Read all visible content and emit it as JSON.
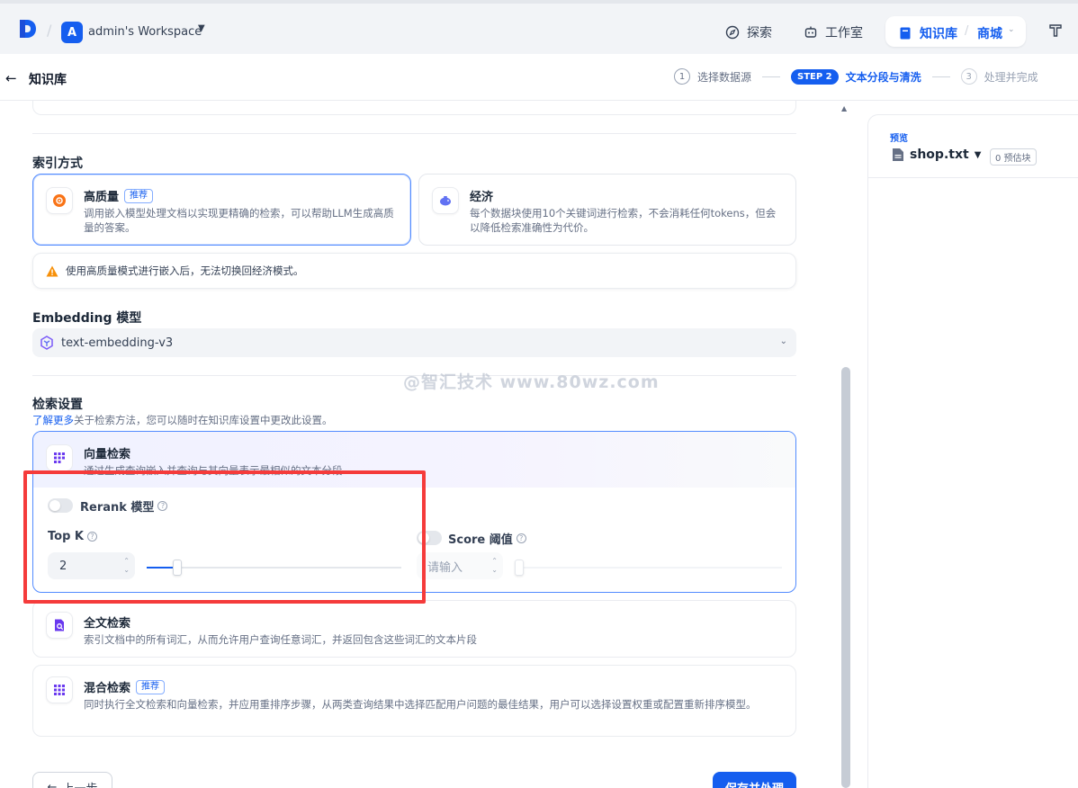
{
  "topnav": {
    "workspace_initial": "A",
    "workspace_name": "admin's Workspace",
    "explore": "探索",
    "studio": "工作室",
    "knowledge": "知识库",
    "mall": "商城"
  },
  "subheader": {
    "back_title": "知识库",
    "steps": {
      "step1_num": "1",
      "step1_label": "选择数据源",
      "step2_badge": "STEP 2",
      "step2_label": "文本分段与清洗",
      "step3_num": "3",
      "step3_label": "处理并完成"
    }
  },
  "index_section": {
    "title": "索引方式",
    "high_quality": {
      "name": "高质量",
      "badge": "推荐",
      "desc": "调用嵌入模型处理文档以实现更精确的检索，可以帮助LLM生成高质量的答案。"
    },
    "economy": {
      "name": "经济",
      "desc": "每个数据块使用10个关键词进行检索，不会消耗任何tokens，但会以降低检索准确性为代价。"
    },
    "warning": "使用高质量模式进行嵌入后，无法切换回经济模式。"
  },
  "embedding": {
    "title": "Embedding 模型",
    "model": "text-embedding-v3"
  },
  "retrieval": {
    "title": "检索设置",
    "learn_more": "了解更多",
    "learn_suffix": "关于检索方法，您可以随时在知识库设置中更改此设置。",
    "vector": {
      "name": "向量检索",
      "desc": "通过生成查询嵌入并查询与其向量表示最相似的文本分段",
      "rerank_label": "Rerank 模型",
      "rerank_on": false,
      "topk_label": "Top K",
      "topk_value": "2",
      "topk_fraction": 0.12,
      "score_label": "Score 阈值",
      "score_on": false,
      "score_placeholder": "请输入"
    },
    "fulltext": {
      "name": "全文检索",
      "desc": "索引文档中的所有词汇，从而允许用户查询任意词汇，并返回包含这些词汇的文本片段"
    },
    "hybrid": {
      "name": "混合检索",
      "badge": "推荐",
      "desc": "同时执行全文检索和向量检索，并应用重排序步骤，从两类查询结果中选择匹配用户问题的最佳结果，用户可以选择设置权重或配置重新排序模型。"
    }
  },
  "footer": {
    "prev": "上一步",
    "save": "保存并处理"
  },
  "watermark": "@智汇技术 www.80wz.com",
  "preview": {
    "label": "预览",
    "file": "shop.txt",
    "chunks": "0 预估块"
  },
  "colors": {
    "accent": "#155eef",
    "highlight_box": "#f53b3b"
  }
}
